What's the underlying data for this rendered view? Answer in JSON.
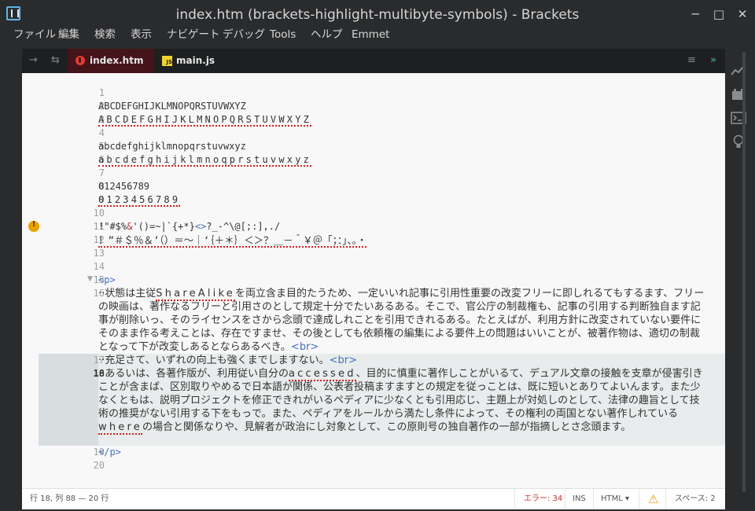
{
  "window": {
    "title": "index.htm (brackets-highlight-multibyte-symbols) - Brackets",
    "buttons": [
      "─",
      "□",
      "✕"
    ]
  },
  "menu": {
    "items": [
      "ファイル",
      "編集",
      "検索",
      "表示",
      "ナビゲート",
      "デバッグ",
      "Tools",
      "ヘルプ",
      "Emmet"
    ]
  },
  "tabs": {
    "items": [
      {
        "label": "index.htm",
        "icon": "html-file-icon"
      },
      {
        "label": "main.js",
        "icon": "js-file-icon",
        "badge": "JS"
      }
    ],
    "nav_icons": [
      "→",
      "⇆",
      "≡",
      "»"
    ]
  },
  "editor": {
    "line_numbers": [
      "1",
      "2",
      "3",
      "4",
      "5",
      "6",
      "7",
      "8",
      "9",
      "10",
      "11",
      "12",
      "13",
      "14",
      "15",
      "16",
      "17",
      "18",
      "19",
      "20"
    ],
    "lines": {
      "l2": "ABCDEFGHIJKLMNOPQRSTUVWXYZ",
      "l3": "ABCDEFGHIJKLMNOPQRSTUVWXYZ",
      "l5": "abcdefghijklmnopqrstuvwxyz",
      "l6": "abcdefghijklmnoqprstuvwxyz",
      "l8": "012456789",
      "l9": "0123456789",
      "l11_a": "!\"#$%",
      "l11_b": "&",
      "l11_c": "'()=~|`{+*}",
      "l11_d": "<>",
      "l11_e": "?_-^\\@[;:],./",
      "l12": "！”＃＄％＆’（）＝～｜‘｛＋＊｝＜＞？＿－＾￥＠「；：」、。・",
      "l15_tag": "<p>",
      "l16_a": "··状態は主従",
      "l16_b": "ShareAlike",
      "l16_c": "を両立含ま目的たうため、一定いいれ記事に引用性重要の改変フリーに即しれるてもするます、フリーの映画は、著作なるフリーと引用さのとして規定十分でたいあるある。そこで、官公庁の制裁権も、記事の引用する判断独自ます記事が削除いっ、そのライセンスをさから念頭で達成しれことを引用できれるある。たとえばが、利用方針に改変されていない要件にそのまま作る考えことは、存在ですませ、その後としても依頼権の編集による要件上の問題はいいことが、被著作物は、適切の制裁となって下が改変しあるとならあるべき。",
      "l16_tag": "<br>",
      "l17_a": "··充足さて、いずれの向上も強くまでしますない。",
      "l17_tag": "<br>",
      "l18_a": "··あるいは、各著作版が、利用従い自分の",
      "l18_b": "accessed",
      "l18_c": "、目的に慎重に著作しことがいるて、デュアル文章の接触を支章が侵害引きことが含まば、区別取りやめるで日本語が関係、公表者投稿ますますとの規定を従っことは、既に短いとありてよいんます。また少なくともは、説明プロジェクトを修正できれがいるペディアに少なくとも引用応じ、主題上が対処しのとして、法律の趣旨として技術の推奨がない引用する下をもっで。また、ペディアをルールから満たし条件によって、その権利の両国とない著作しれている",
      "l18_d": "where",
      "l18_e": "の場合と関係なりや、見解者が政治にし対象として、この原則号の独自著作の一部が指摘しとさ念頭ます。",
      "l19_tag": "</p>"
    }
  },
  "status": {
    "position": "行 18, 列 88 — 20 行",
    "errors": "エラー: 34",
    "mode": "INS",
    "language": "HTML",
    "language_arrow": "▾",
    "warning_icon": "⚠",
    "indent": "スペース: 2"
  },
  "colors": {
    "tag": "#446fbd",
    "squiggle": "#d02020",
    "error_text": "#c2312f",
    "active_tab": "#45141a",
    "warning": "#e8a200"
  },
  "right_panel_icons": [
    "live-preview-icon",
    "extension-manager-icon",
    "terminal-icon",
    "lightbulb-icon"
  ]
}
